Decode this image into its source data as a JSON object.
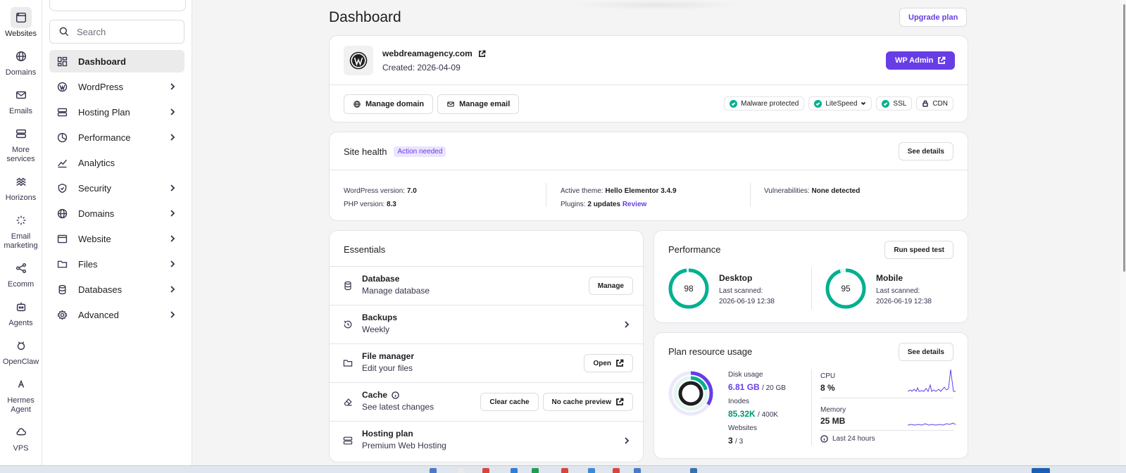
{
  "rail": [
    {
      "label": "Websites",
      "icon": "browser-window-icon",
      "active": true
    },
    {
      "label": "Domains",
      "icon": "globe-icon"
    },
    {
      "label": "Emails",
      "icon": "mail-icon"
    },
    {
      "label": "More services",
      "icon": "server-icon"
    },
    {
      "label": "Horizons",
      "icon": "horizons-icon"
    },
    {
      "label": "Email marketing",
      "icon": "sparkle-icon"
    },
    {
      "label": "Ecomm",
      "icon": "ecomm-icon"
    },
    {
      "label": "Agents",
      "icon": "robot-icon"
    },
    {
      "label": "OpenClaw",
      "icon": "claw-icon"
    },
    {
      "label": "Hermes Agent",
      "icon": "hermes-icon"
    },
    {
      "label": "VPS",
      "icon": "cloud-icon"
    }
  ],
  "sidebar": {
    "search_placeholder": "Search",
    "items": [
      {
        "label": "Dashboard",
        "icon": "dashboard-icon",
        "active": true
      },
      {
        "label": "WordPress",
        "icon": "wordpress-icon",
        "chevron": true
      },
      {
        "label": "Hosting Plan",
        "icon": "server-icon",
        "chevron": true
      },
      {
        "label": "Performance",
        "icon": "pie-chart-icon",
        "chevron": true
      },
      {
        "label": "Analytics",
        "icon": "trend-icon"
      },
      {
        "label": "Security",
        "icon": "shield-icon",
        "chevron": true
      },
      {
        "label": "Domains",
        "icon": "globe-icon",
        "chevron": true
      },
      {
        "label": "Website",
        "icon": "browser-window-icon",
        "chevron": true
      },
      {
        "label": "Files",
        "icon": "folder-icon",
        "chevron": true
      },
      {
        "label": "Databases",
        "icon": "database-icon",
        "chevron": true
      },
      {
        "label": "Advanced",
        "icon": "gear-icon",
        "chevron": true
      }
    ]
  },
  "page": {
    "title": "Dashboard",
    "upgrade_label": "Upgrade plan"
  },
  "site": {
    "domain": "webdreamagency.com",
    "created": "Created: 2026-04-09",
    "wp_admin_label": "WP Admin",
    "manage_domain_label": "Manage domain",
    "manage_email_label": "Manage email",
    "badges": {
      "malware": "Malware protected",
      "litespeed": "LiteSpeed",
      "ssl": "SSL",
      "cdn": "CDN"
    }
  },
  "health": {
    "title": "Site health",
    "status": "Action needed",
    "see_details": "See details",
    "wp_version_label": "WordPress version:",
    "wp_version": "7.0",
    "php_version_label": "PHP version:",
    "php_version": "8.3",
    "theme_label": "Active theme:",
    "theme": "Hello Elementor 3.4.9",
    "plugins_label": "Plugins:",
    "plugins": "2 updates",
    "review_label": "Review",
    "vuln_label": "Vulnerabilities:",
    "vuln": "None detected"
  },
  "essentials": {
    "title": "Essentials",
    "rows": [
      {
        "title": "Database",
        "sub": "Manage database",
        "icon": "database-icon",
        "button": "Manage"
      },
      {
        "title": "Backups",
        "sub": "Weekly",
        "icon": "history-icon"
      },
      {
        "title": "File manager",
        "sub": "Edit your files",
        "icon": "folder-icon",
        "button": "Open"
      },
      {
        "title": "Cache",
        "sub": "See latest changes",
        "icon": "eraser-icon",
        "button": "Clear cache",
        "button2": "No cache preview"
      },
      {
        "title": "Hosting plan",
        "sub": "Premium Web Hosting",
        "icon": "server-icon"
      }
    ]
  },
  "performance": {
    "title": "Performance",
    "speed_label": "Run speed test",
    "desktop": {
      "label": "Desktop",
      "score": "98",
      "scanned_label": "Last scanned:",
      "scanned": "2026-06-19 12:38"
    },
    "mobile": {
      "label": "Mobile",
      "score": "95",
      "scanned_label": "Last scanned:",
      "scanned": "2026-06-19 12:38"
    },
    "color": "#00b090"
  },
  "plan": {
    "title": "Plan resource usage",
    "see_details": "See details",
    "disk_label": "Disk usage",
    "disk_used": "6.81 GB",
    "disk_total": "/ 20 GB",
    "inodes_label": "Inodes",
    "inodes_used": "85.32K",
    "inodes_total": "/ 400K",
    "websites_label": "Websites",
    "websites_used": "3",
    "websites_total": "/ 3",
    "disk_fraction": 0.34,
    "inodes_fraction": 0.21,
    "websites_fraction": 1.0,
    "cpu_label": "CPU",
    "cpu": "8 %",
    "memory_label": "Memory",
    "memory": "25 MB",
    "period": "Last 24 hours",
    "accent": "#673de6",
    "green": "#00b090"
  }
}
